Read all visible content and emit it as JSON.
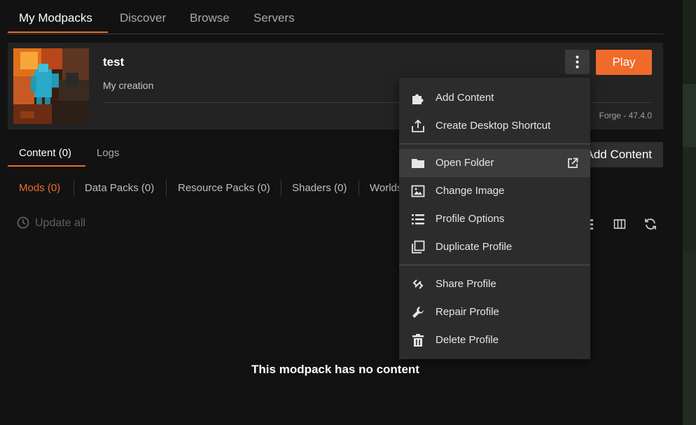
{
  "top_tabs": {
    "my_modpacks": "My Modpacks",
    "discover": "Discover",
    "browse": "Browse",
    "servers": "Servers"
  },
  "profile": {
    "name": "test",
    "description": "My creation",
    "loader": "Forge - 47.4.0",
    "play_label": "Play",
    "menu_icon": "vertical-dots-icon"
  },
  "content_tabs": {
    "content": "Content (0)",
    "logs": "Logs",
    "add_content": "Add Content"
  },
  "categories": {
    "mods": "Mods (0)",
    "data_packs": "Data Packs (0)",
    "resource_packs": "Resource Packs (0)",
    "shaders": "Shaders (0)",
    "worlds": "Worlds"
  },
  "toolbar": {
    "update_all": "Update all"
  },
  "empty_message": "This modpack has no content",
  "dropdown": {
    "add_content": "Add Content",
    "create_shortcut": "Create Desktop Shortcut",
    "open_folder": "Open Folder",
    "change_image": "Change Image",
    "profile_options": "Profile Options",
    "duplicate_profile": "Duplicate Profile",
    "share_profile": "Share Profile",
    "repair_profile": "Repair Profile",
    "delete_profile": "Delete Profile"
  },
  "colors": {
    "accent": "#f06a2a",
    "background": "#121212",
    "card": "#232323",
    "menu": "#2c2c2c"
  }
}
